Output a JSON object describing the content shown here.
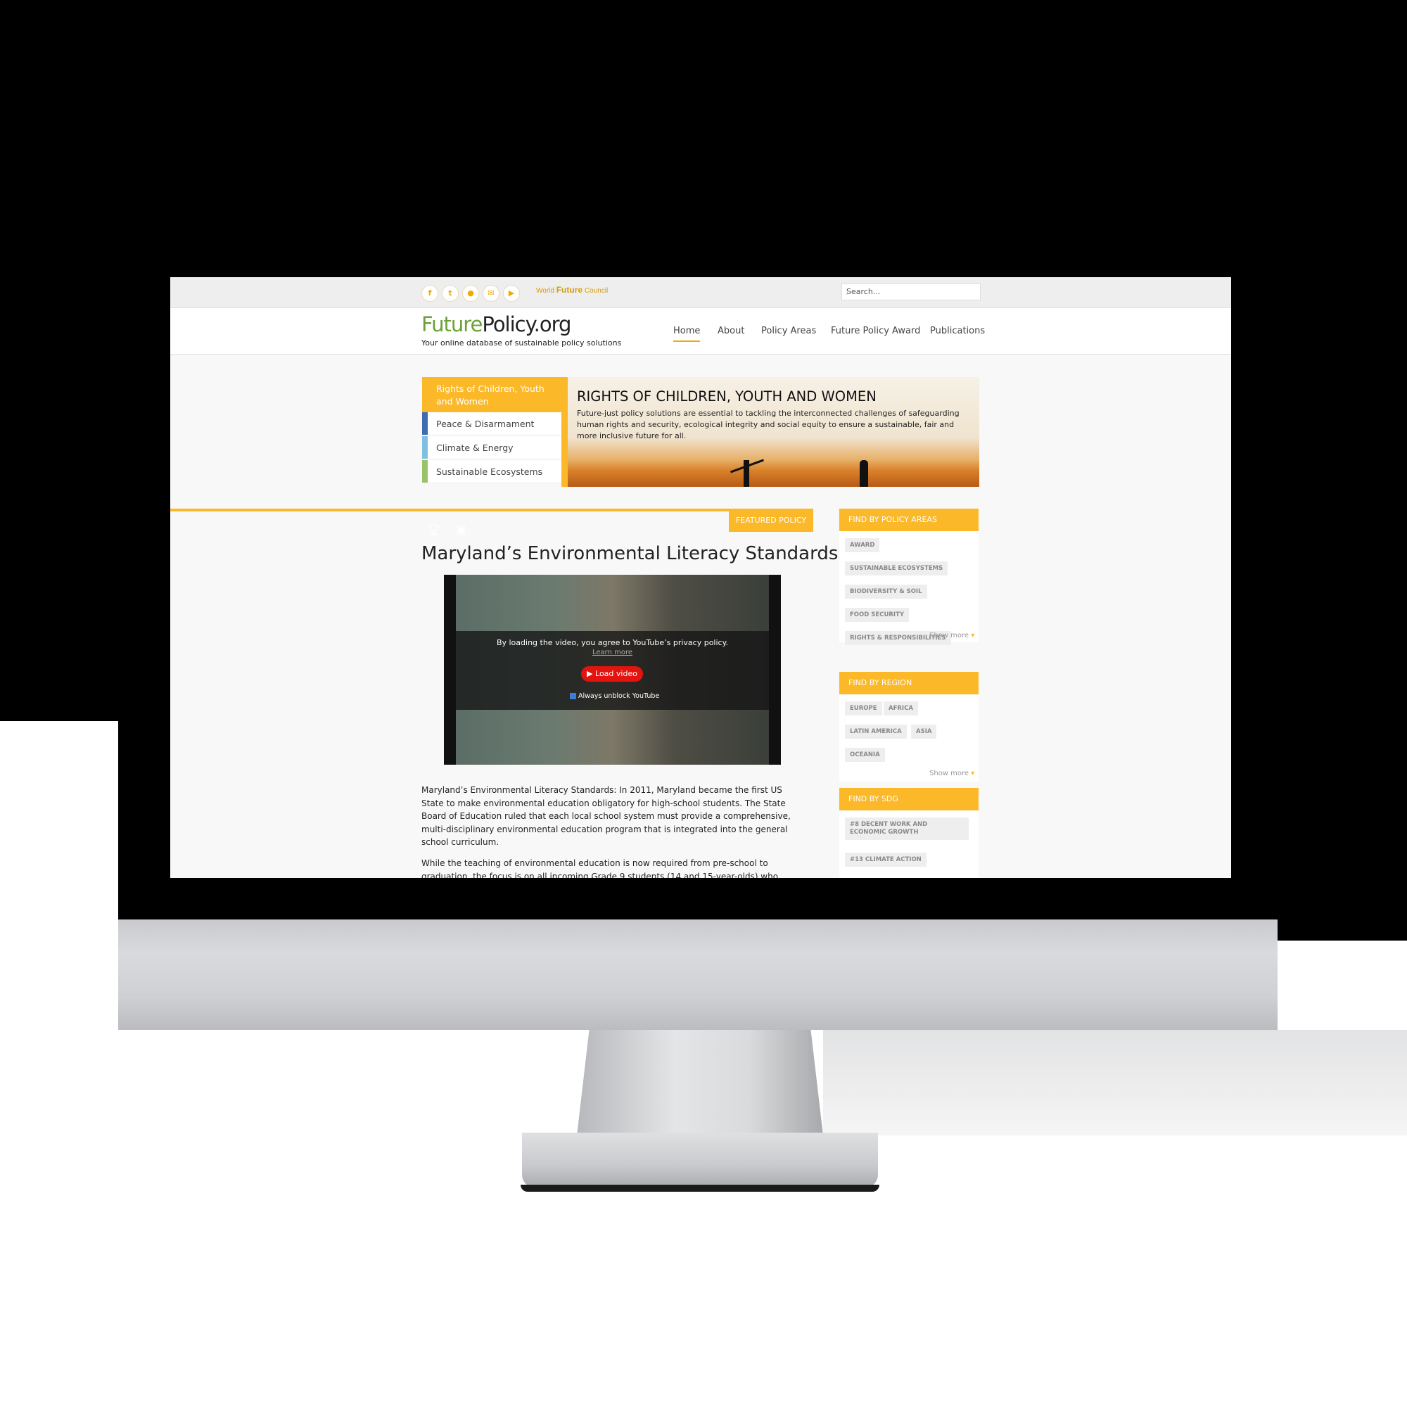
{
  "topbar": {
    "social_icons": [
      "facebook-icon",
      "twitter-icon",
      "flickr-icon",
      "email-icon",
      "youtube-icon"
    ],
    "social_glyphs": [
      "f",
      "t",
      "●",
      "✉",
      "▶"
    ],
    "wfc_world": "World",
    "wfc_future": "Future",
    "wfc_council": "Council",
    "search_placeholder": "Search..."
  },
  "header": {
    "logo_part1": "Future",
    "logo_part2": "Policy.org",
    "tagline": "Your online database of sustainable policy solutions",
    "nav": [
      "Home",
      "About",
      "Policy Areas",
      "Future Policy Award",
      "Publications"
    ],
    "active_nav": "Home"
  },
  "banner": {
    "categories": [
      {
        "label": "Rights of Children, Youth and Women",
        "color": "#fbb829"
      },
      {
        "label": "Peace & Disarmament",
        "color": "#3d6db0"
      },
      {
        "label": "Climate & Energy",
        "color": "#7fc0e0"
      },
      {
        "label": "Sustainable Ecosystems",
        "color": "#9ac26a"
      }
    ],
    "hero_title": "RIGHTS OF CHILDREN, YOUTH AND WOMEN",
    "hero_text": "Future-just policy solutions are essential to tackling the interconnected challenges of safeguarding human rights and security, ecological integrity and social equity to ensure a sustainable, fair and more inclusive future for all."
  },
  "article": {
    "featured_label": "FEATURED POLICY",
    "badges": [
      {
        "icon": "trophy-icon",
        "color": "#777777"
      },
      {
        "icon": "blackboard-icon",
        "color": "#1f9a4a"
      }
    ],
    "title": "Maryland’s Environmental Literacy Standards",
    "video": {
      "consent_text": "By loading the video, you agree to YouTube’s privacy policy.",
      "learn_more": "Learn more",
      "load_button": "Load video",
      "always_unblock": "Always unblock YouTube"
    },
    "paragraph1": "Maryland’s Environmental Literacy Standards: In 2011, Maryland became the first US State to make environmental education obligatory for high-school students. The State Board of Education ruled that each local school system must provide a comprehensive, multi-disciplinary environmental education program that is integrated into the general school curriculum.",
    "paragraph2": "While the teaching of environmental education is now required from pre-school to graduation, the focus is on all incoming Grade 9 students (14 and 15-year-olds) who must complete a"
  },
  "sidebar": {
    "policy_areas": {
      "heading": "FIND BY POLICY AREAS",
      "tags": [
        "AWARD",
        "SUSTAINABLE ECOSYSTEMS",
        "BIODIVERSITY & SOIL",
        "FOOD SECURITY",
        "RIGHTS & RESPONSIBILITIES"
      ],
      "show_more": "Show more"
    },
    "region": {
      "heading": "FIND BY REGION",
      "tags": [
        "EUROPE",
        "AFRICA",
        "LATIN AMERICA",
        "ASIA",
        "OCEANIA"
      ],
      "show_more": "Show more"
    },
    "sdg": {
      "heading": "FIND BY SDG",
      "tags": [
        "#8 DECENT WORK AND ECONOMIC GROWTH",
        "#13 CLIMATE ACTION"
      ]
    }
  },
  "colors": {
    "accent": "#fbb829",
    "logo_green": "#6aa236",
    "youtube_red": "#e3140f"
  }
}
